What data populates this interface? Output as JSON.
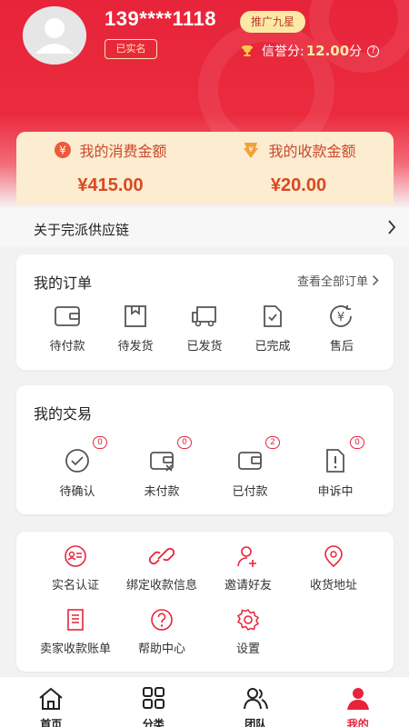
{
  "profile": {
    "phone": "139****1118",
    "level_badge": "推广九星",
    "verified_badge": "已实名",
    "credit_label": "信誉分:",
    "credit_value": "12.00",
    "credit_unit": "分",
    "credit_help": "?"
  },
  "amounts": {
    "consume_label": "我的消费金额",
    "consume_value": "¥415.00",
    "receive_label": "我的收款金额",
    "receive_value": "¥20.00"
  },
  "about": {
    "label": "关于完派供应链"
  },
  "orders": {
    "title": "我的订单",
    "view_all": "查看全部订单",
    "items": [
      {
        "label": "待付款",
        "icon": "wallet-icon"
      },
      {
        "label": "待发货",
        "icon": "package-icon"
      },
      {
        "label": "已发货",
        "icon": "truck-icon"
      },
      {
        "label": "已完成",
        "icon": "document-check-icon"
      },
      {
        "label": "售后",
        "icon": "yuan-refresh-icon"
      }
    ]
  },
  "trades": {
    "title": "我的交易",
    "items": [
      {
        "label": "待确认",
        "count": "0",
        "icon": "check-circle-icon"
      },
      {
        "label": "未付款",
        "count": "0",
        "icon": "wallet-x-icon"
      },
      {
        "label": "已付款",
        "count": "2",
        "icon": "wallet-icon"
      },
      {
        "label": "申诉中",
        "count": "0",
        "icon": "document-alert-icon"
      }
    ]
  },
  "services": {
    "items": [
      {
        "label": "实名认证",
        "icon": "id-card-icon"
      },
      {
        "label": "绑定收款信息",
        "icon": "link-icon"
      },
      {
        "label": "邀请好友",
        "icon": "user-add-icon"
      },
      {
        "label": "收货地址",
        "icon": "location-icon"
      },
      {
        "label": "卖家收款账单",
        "icon": "bill-icon"
      },
      {
        "label": "帮助中心",
        "icon": "help-icon"
      },
      {
        "label": "设置",
        "icon": "gear-icon"
      }
    ]
  },
  "tabbar": {
    "items": [
      {
        "label": "首页",
        "icon": "home-icon"
      },
      {
        "label": "分类",
        "icon": "category-icon"
      },
      {
        "label": "团队",
        "icon": "team-icon"
      },
      {
        "label": "我的",
        "icon": "profile-icon",
        "active": true
      }
    ]
  },
  "colors": {
    "primary": "#e8243a",
    "gold": "#fde9a6",
    "amount_text": "#d94a22",
    "amount_card": "#fcecd0"
  }
}
